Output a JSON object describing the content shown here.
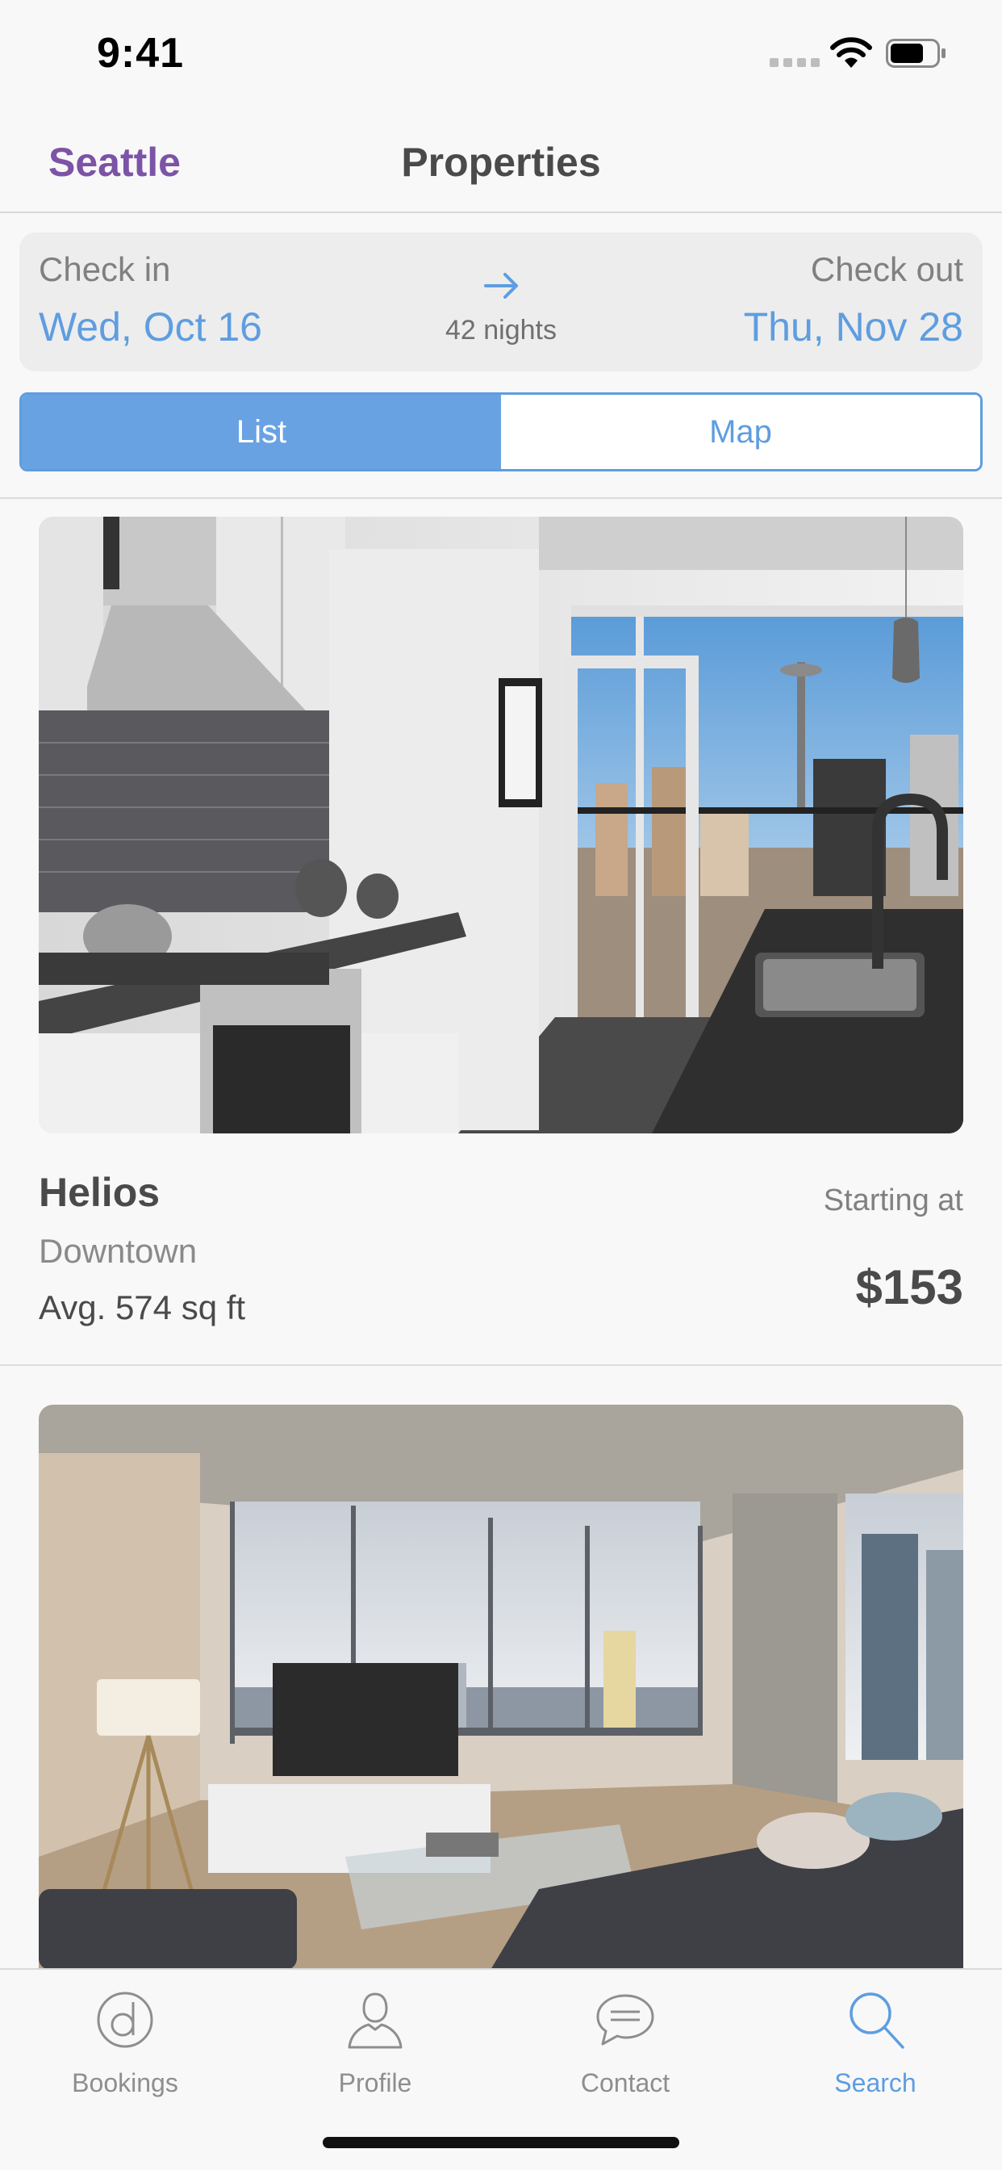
{
  "status_bar": {
    "time": "9:41"
  },
  "nav": {
    "back_label": "Seattle",
    "title": "Properties"
  },
  "dates": {
    "check_in_label": "Check in",
    "check_in_date": "Wed, Oct 16",
    "check_out_label": "Check out",
    "check_out_date": "Thu, Nov 28",
    "nights": "42 nights"
  },
  "view_toggle": {
    "list_label": "List",
    "map_label": "Map",
    "selected": "List"
  },
  "listings": [
    {
      "name": "Helios",
      "neighborhood": "Downtown",
      "size": "Avg. 574 sq ft",
      "price_prefix": "Starting at",
      "price": "$153"
    }
  ],
  "tab_bar": {
    "items": [
      {
        "label": "Bookings",
        "icon": "bookings-icon"
      },
      {
        "label": "Profile",
        "icon": "profile-icon"
      },
      {
        "label": "Contact",
        "icon": "chat-bubble-icon"
      },
      {
        "label": "Search",
        "icon": "search-icon"
      }
    ],
    "active": "Search"
  },
  "colors": {
    "accent_blue": "#5e9de0",
    "brand_purple": "#7c53a6",
    "text_dark": "#4a4a4a",
    "text_gray": "#808080"
  }
}
